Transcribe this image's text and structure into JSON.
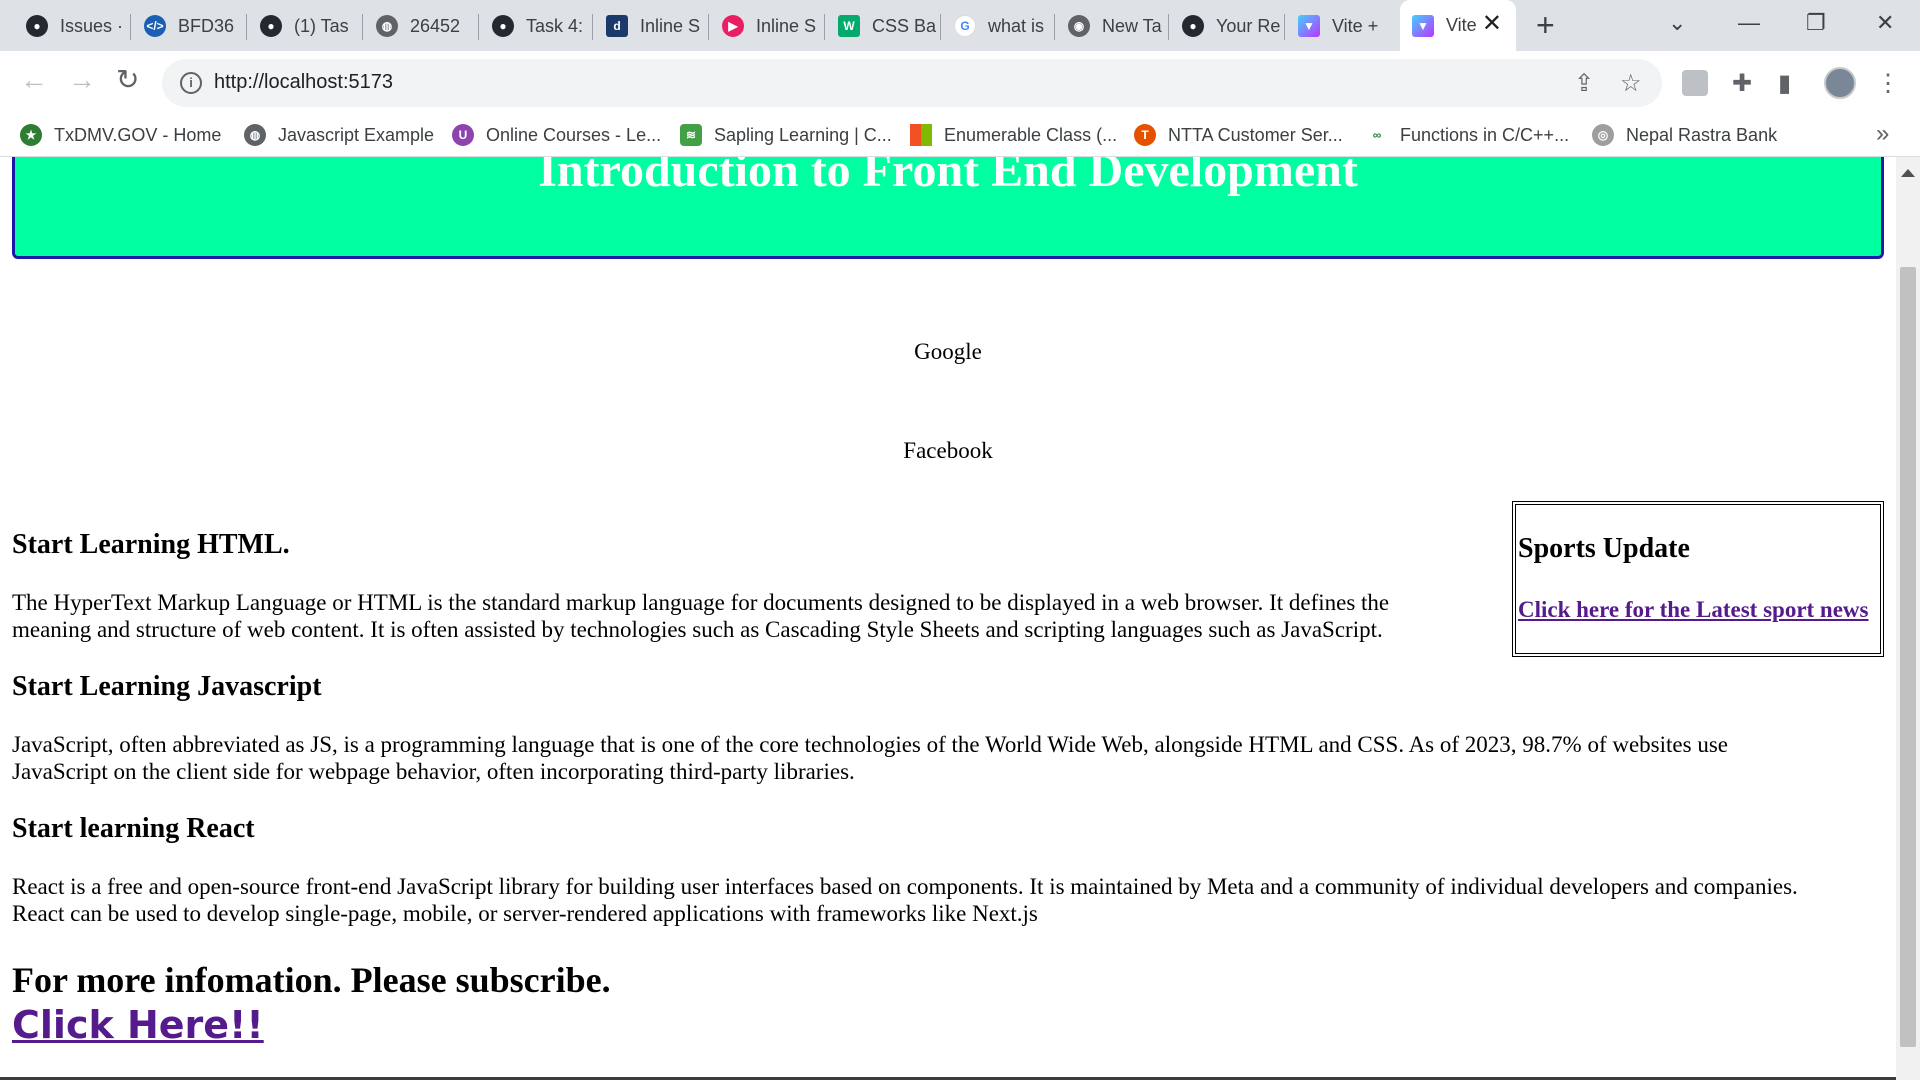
{
  "browser": {
    "tabs": [
      {
        "title": "Issues ·",
        "icon": "github-icon",
        "color": "#24292f"
      },
      {
        "title": "BFD36",
        "icon": "code-icon",
        "color": "#1b5fb4"
      },
      {
        "title": "(1) Tas",
        "icon": "github-icon",
        "color": "#24292f"
      },
      {
        "title": "26452",
        "icon": "globe-icon",
        "color": "#5f6368"
      },
      {
        "title": "Task 4:",
        "icon": "github-icon",
        "color": "#24292f"
      },
      {
        "title": "Inline S",
        "icon": "document-icon",
        "color": "#1b3a6b"
      },
      {
        "title": "Inline S",
        "icon": "play-icon",
        "color": "#e91e63"
      },
      {
        "title": "CSS Ba",
        "icon": "w3schools-icon",
        "color": "#04aa6d"
      },
      {
        "title": "what is",
        "icon": "google-icon",
        "color": "#4285f4"
      },
      {
        "title": "New Ta",
        "icon": "chrome-icon",
        "color": "#5f6368"
      },
      {
        "title": "Your Re",
        "icon": "github-icon",
        "color": "#24292f"
      },
      {
        "title": "Vite +",
        "icon": "vite-icon",
        "color": "#a259ff"
      }
    ],
    "active_tab": {
      "title": "Vite",
      "icon": "vite-icon",
      "color": "#a259ff"
    },
    "url": "http://localhost:5173",
    "bookmarks": [
      {
        "label": "TxDMV.GOV - Home",
        "color": "#2e7d32"
      },
      {
        "label": "Javascript Example",
        "color": "#5f6368"
      },
      {
        "label": "Online Courses - Le...",
        "color": "#8e44ad"
      },
      {
        "label": "Sapling Learning | C...",
        "color": "#43a047"
      },
      {
        "label": "Enumerable Class (...",
        "color": "#f25022"
      },
      {
        "label": "NTTA Customer Ser...",
        "color": "#e65100"
      },
      {
        "label": "Functions in C/C++...",
        "color": "#2e7d32"
      },
      {
        "label": "Nepal Rastra Bank",
        "color": "#9e9e9e"
      }
    ]
  },
  "page": {
    "banner_title": "Introduction to Front End Development",
    "nav_links": [
      "Google",
      "Facebook"
    ],
    "sections": [
      {
        "heading": "Start Learning HTML.",
        "body_line1": "The HyperText Markup Language or HTML is the standard markup language for documents designed to be displayed in a web browser. It defines the",
        "body_line2": "meaning and structure of web content. It is often assisted by technologies such as Cascading Style Sheets and scripting languages such as JavaScript."
      },
      {
        "heading": "Start Learning Javascript",
        "body_line1": "JavaScript, often abbreviated as JS, is a programming language that is one of the core technologies of the World Wide Web, alongside HTML and CSS. As of 2023, 98.7% of websites use",
        "body_line2": "JavaScript on the client side for webpage behavior, often incorporating third-party libraries."
      },
      {
        "heading": "Start learning React",
        "body_line1": "React is a free and open-source front-end JavaScript library for building user interfaces based on components. It is maintained by Meta and a community of individual developers and companies.",
        "body_line2": "React can be used to develop single-page, mobile, or server-rendered applications with frameworks like Next.js"
      }
    ],
    "sidebar": {
      "heading": "Sports Update",
      "link": "Click here for the Latest sport news"
    },
    "subscribe_text": "For more infomation. Please subscribe.",
    "subscribe_link": "Click Here!!",
    "colors": {
      "banner_bg": "#00ffa1",
      "banner_border": "#1a1aa6",
      "visited_link": "#551a8b"
    }
  }
}
